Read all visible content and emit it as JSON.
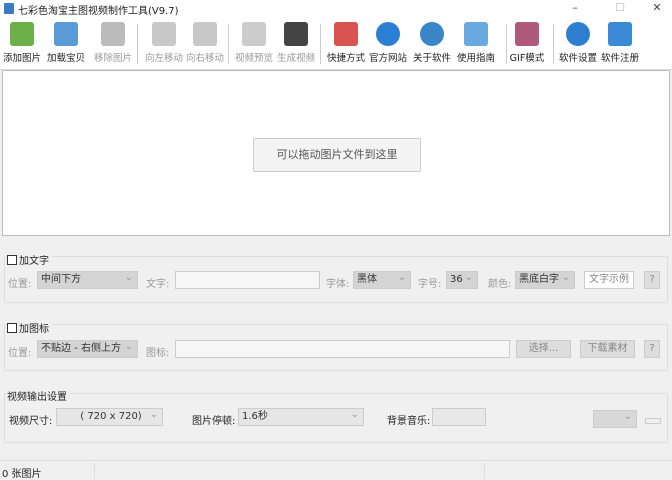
{
  "window": {
    "title": "七彩色淘宝主图视频制作工具(V9.7)",
    "minimize": "–",
    "maximize": "☐",
    "close": "✕"
  },
  "toolbar": [
    {
      "label": "添加图片",
      "icon": "add-image-icon",
      "color": "#6cb04a",
      "enabled": true
    },
    {
      "label": "加载宝贝",
      "icon": "load-item-icon",
      "color": "#5a9ad6",
      "enabled": true
    },
    {
      "label": "移除图片",
      "icon": "remove-image-icon",
      "color": "#bbbbbb",
      "enabled": false
    },
    {
      "label": "向左移动",
      "icon": "arrow-left-icon",
      "color": "#c8c8c8",
      "enabled": false
    },
    {
      "label": "向右移动",
      "icon": "arrow-right-icon",
      "color": "#c8c8c8",
      "enabled": false
    },
    {
      "label": "视频预览",
      "icon": "magnifier-icon",
      "color": "#cccccc",
      "enabled": false
    },
    {
      "label": "生成视频",
      "icon": "clapperboard-icon",
      "color": "#444444",
      "enabled": false
    },
    {
      "label": "快捷方式",
      "icon": "cubes-icon",
      "color": "#d9534f",
      "enabled": true
    },
    {
      "label": "官方网站",
      "icon": "ie-icon",
      "color": "#2a7fd4",
      "enabled": true
    },
    {
      "label": "关于软件",
      "icon": "info-icon",
      "color": "#3a86c8",
      "enabled": true
    },
    {
      "label": "使用指南",
      "icon": "guide-icon",
      "color": "#6aa8e0",
      "enabled": true
    },
    {
      "label": "GIF模式",
      "icon": "gif-film-icon",
      "color": "#b05a7a",
      "enabled": true
    },
    {
      "label": "软件设置",
      "icon": "gear-icon",
      "color": "#2f7fd0",
      "enabled": true
    },
    {
      "label": "软件注册",
      "icon": "monitor-icon",
      "color": "#3a8ad8",
      "enabled": true
    }
  ],
  "drop_hint": "可以拖动图片文件到这里",
  "text_section": {
    "title": "加文字",
    "position_label": "位置:",
    "position_value": "中间下方",
    "text_label": "文字:",
    "font_label": "字体:",
    "font_value": "黑体",
    "size_label": "字号:",
    "size_value": "36",
    "color_label": "颜色:",
    "color_value": "黑底白字",
    "sample_button": "文字示例",
    "help": "?"
  },
  "icon_section": {
    "title": "加图标",
    "position_label": "位置:",
    "position_value": "不贴边 - 右侧上方",
    "icon_label": "图标:",
    "choose_button": "选择...",
    "download_button": "下载素材",
    "help": "?"
  },
  "output": {
    "title": "视频输出设置",
    "size_label": "视频尺寸:",
    "size_value": "( 720 x  720)",
    "pause_label": "图片停顿:",
    "pause_value": "1.6秒",
    "music_label": "背景音乐:"
  },
  "status": {
    "count": "0 张图片"
  }
}
